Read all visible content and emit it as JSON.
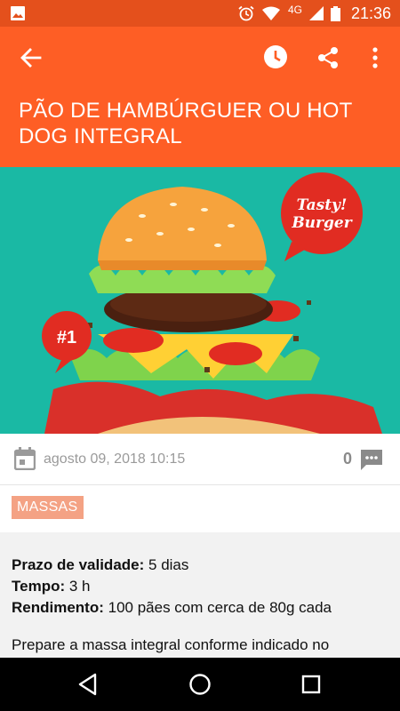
{
  "status_bar": {
    "network": "4G",
    "time": "21:36"
  },
  "header": {
    "title": "PÃO DE HAMBÚRGUER OU HOT DOG INTEGRAL"
  },
  "hero_image": {
    "badge_text": "Tasty! Burger",
    "number_badge": "#1"
  },
  "meta": {
    "date": "agosto 09, 2018 10:15",
    "comment_count": "0"
  },
  "category": {
    "label": "MASSAS"
  },
  "content": {
    "validity_label": "Prazo de validade:",
    "validity_value": "5 dias",
    "time_label": "Tempo:",
    "time_value": "3 h",
    "yield_label": "Rendimento:",
    "yield_value": "100 pães com cerca de 80g cada",
    "paragraph": "Prepare a massa integral conforme indicado no"
  },
  "colors": {
    "status_bar": "#e4501c",
    "app_bar": "#fe5e25",
    "hero_bg": "#1ab9a4",
    "tag_bg": "#f4a284"
  }
}
